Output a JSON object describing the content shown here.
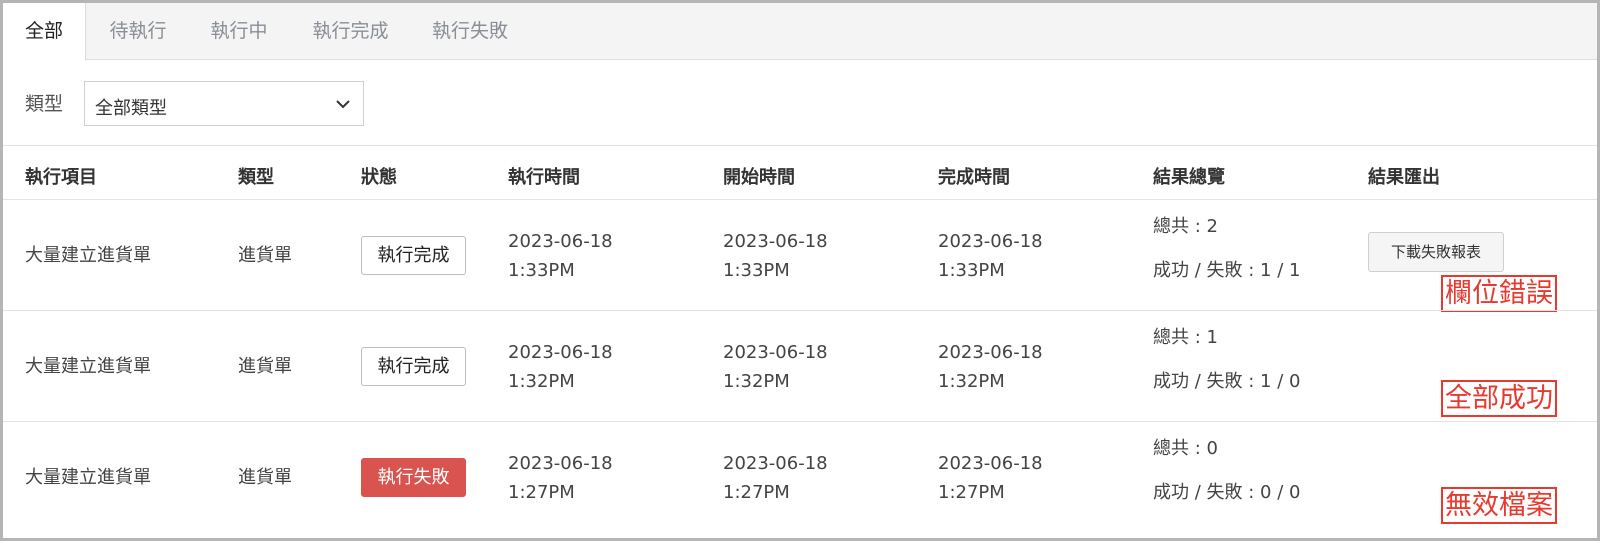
{
  "tabs": [
    "全部",
    "待執行",
    "執行中",
    "執行完成",
    "執行失敗"
  ],
  "filter": {
    "label": "類型",
    "selected": "全部類型"
  },
  "table": {
    "headers": [
      "執行項目",
      "類型",
      "狀態",
      "執行時間",
      "開始時間",
      "完成時間",
      "結果總覽",
      "結果匯出"
    ],
    "rows": [
      {
        "item": "大量建立進貨單",
        "type": "進貨單",
        "status": "執行完成",
        "exec_date": "2023-06-18",
        "exec_time": "1:33PM",
        "start_date": "2023-06-18",
        "start_time": "1:33PM",
        "end_date": "2023-06-18",
        "end_time": "1:33PM",
        "total": "總共 : 2",
        "result": "成功 / 失敗 : 1 / 1",
        "export": "下載失敗報表"
      },
      {
        "item": "大量建立進貨單",
        "type": "進貨單",
        "status": "執行完成",
        "exec_date": "2023-06-18",
        "exec_time": "1:32PM",
        "start_date": "2023-06-18",
        "start_time": "1:32PM",
        "end_date": "2023-06-18",
        "end_time": "1:32PM",
        "total": "總共 : 1",
        "result": "成功 / 失敗 : 1 / 0"
      },
      {
        "item": "大量建立進貨單",
        "type": "進貨單",
        "status": "執行失敗",
        "exec_date": "2023-06-18",
        "exec_time": "1:27PM",
        "start_date": "2023-06-18",
        "start_time": "1:27PM",
        "end_date": "2023-06-18",
        "end_time": "1:27PM",
        "total": "總共 : 0",
        "result": "成功 / 失敗 : 0 / 0"
      }
    ]
  },
  "annotations": [
    "欄位錯誤",
    "全部成功",
    "無效檔案"
  ],
  "colors": {
    "fail_badge": "#d9534f",
    "annotation": "#e8392e"
  }
}
